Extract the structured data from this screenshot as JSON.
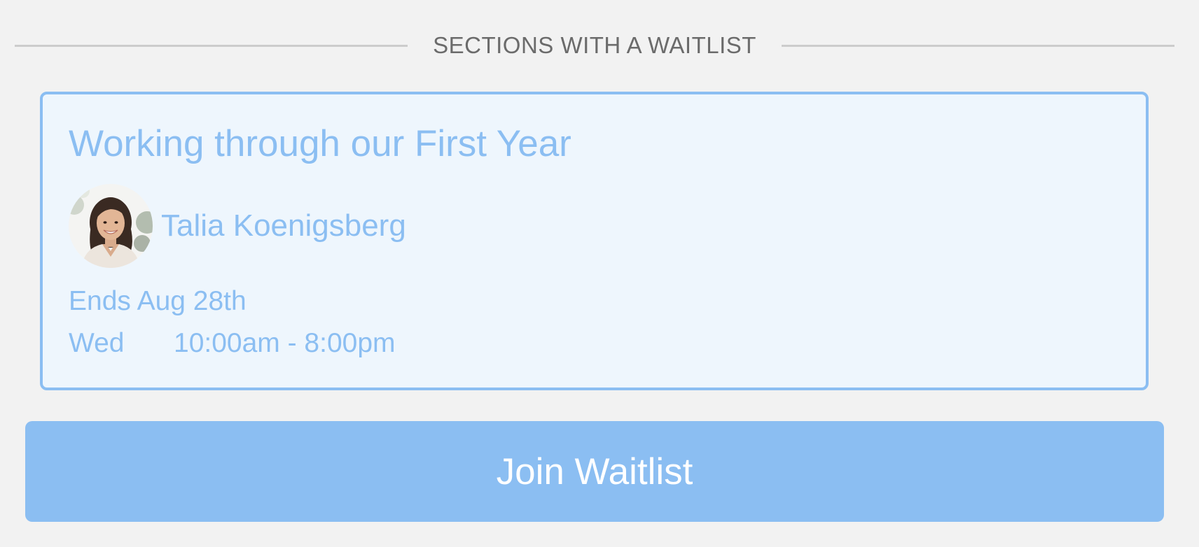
{
  "section": {
    "heading": "SECTIONS WITH A WAITLIST"
  },
  "card": {
    "title": "Working through our First Year",
    "instructor": {
      "name": "Talia Koenigsberg",
      "avatar_icon": "instructor-photo"
    },
    "ends": "Ends Aug 28th",
    "schedule": {
      "day": "Wed",
      "time": "10:00am - 8:00pm"
    }
  },
  "actions": {
    "join_label": "Join Waitlist"
  },
  "colors": {
    "accent": "#8bbef2",
    "card_background": "#eef6fd",
    "page_background": "#f2f2f2",
    "heading_text": "#6b6b6b",
    "divider": "#cccccc"
  }
}
